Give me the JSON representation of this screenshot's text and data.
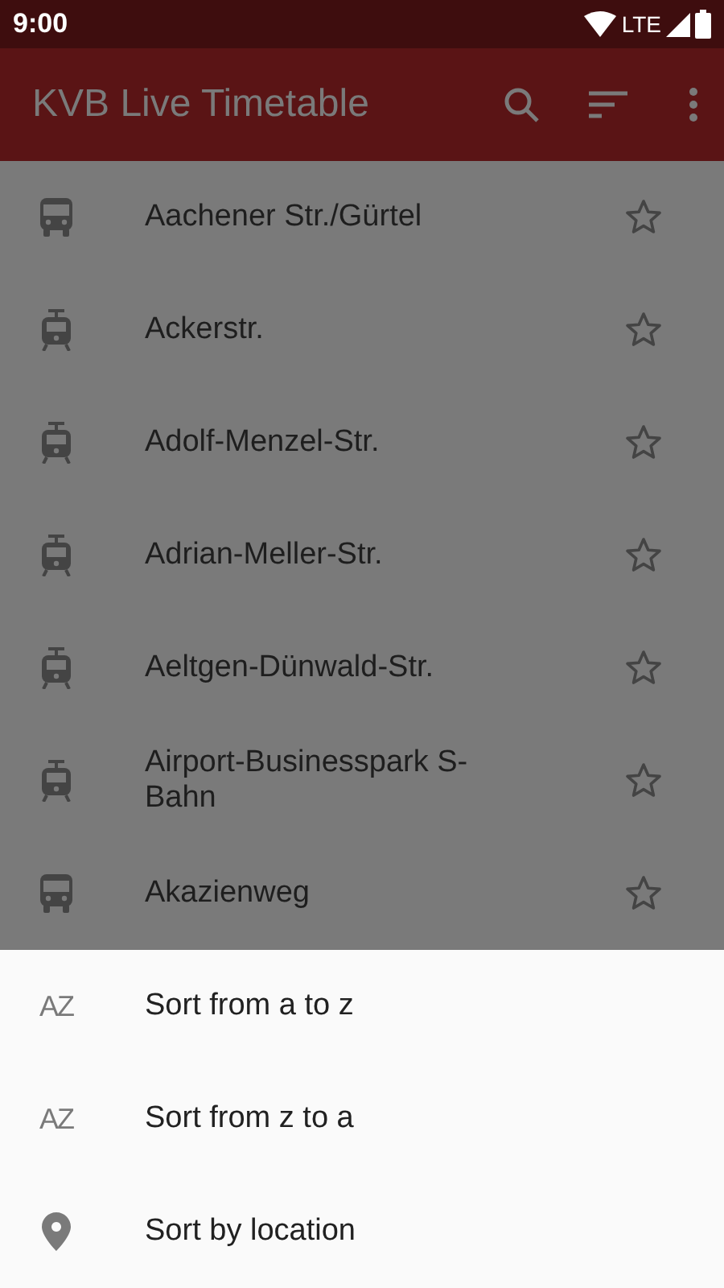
{
  "status_bar": {
    "time": "9:00",
    "network": "LTE"
  },
  "app_bar": {
    "title": "KVB Live Timetable"
  },
  "stops": [
    {
      "name": "Aachener Str./Gürtel",
      "kind": "bus",
      "favorite": false
    },
    {
      "name": "Ackerstr.",
      "kind": "tram",
      "favorite": false
    },
    {
      "name": "Adolf-Menzel-Str.",
      "kind": "tram",
      "favorite": false
    },
    {
      "name": "Adrian-Meller-Str.",
      "kind": "tram",
      "favorite": false
    },
    {
      "name": "Aeltgen-Dünwald-Str.",
      "kind": "tram",
      "favorite": false
    },
    {
      "name": "Airport-Businesspark S-Bahn",
      "kind": "tram",
      "favorite": false
    },
    {
      "name": "Akazienweg",
      "kind": "bus",
      "favorite": false
    }
  ],
  "sort_sheet": [
    {
      "label": "Sort from a to z",
      "kind": "alpha",
      "icon_letters": "AZ"
    },
    {
      "label": "Sort from z to a",
      "kind": "alpha",
      "icon_letters": "AZ"
    },
    {
      "label": "Sort by location",
      "kind": "location"
    }
  ]
}
